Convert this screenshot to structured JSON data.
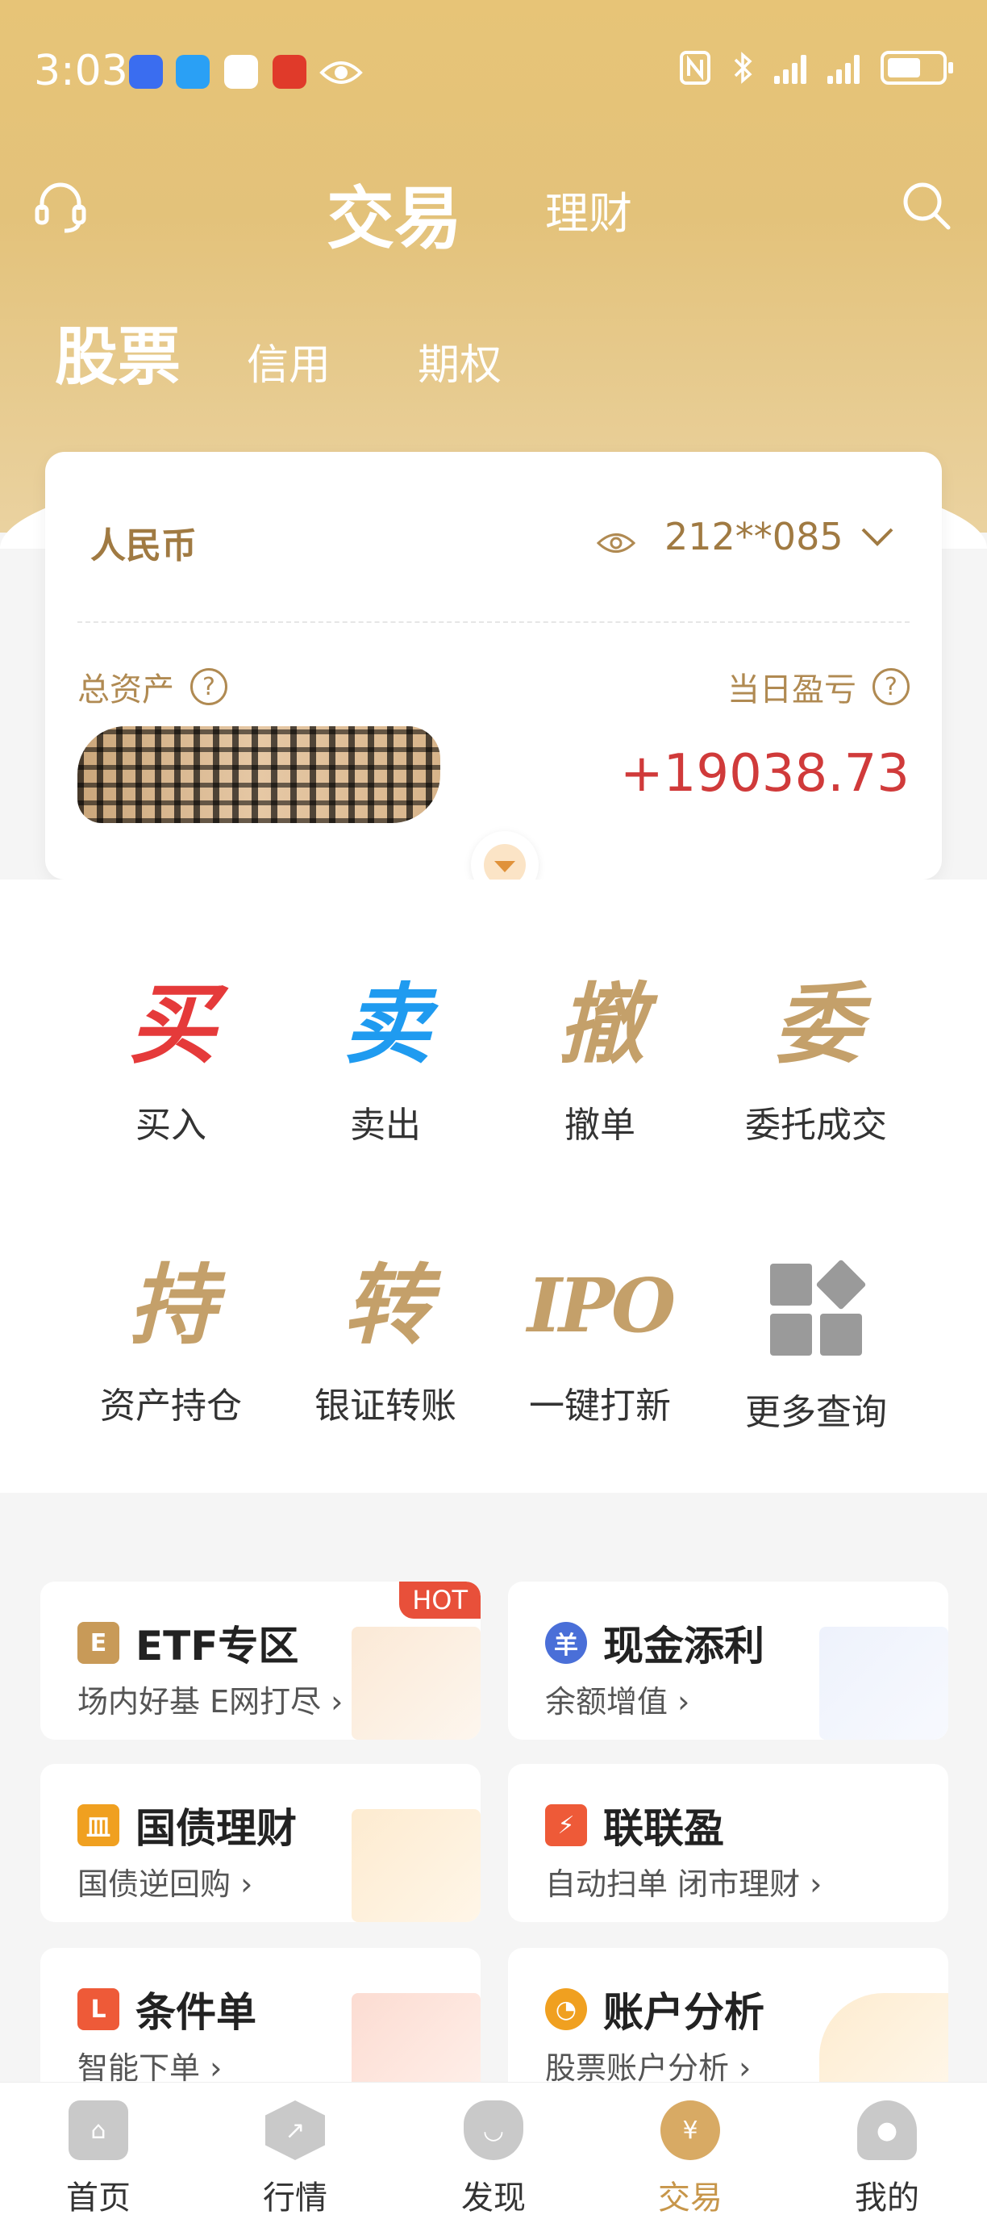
{
  "status_bar": {
    "time": "3:03"
  },
  "header": {
    "tab_main": "交易",
    "tab_sub": "理财"
  },
  "sub_tabs": [
    "股票",
    "信用",
    "期权"
  ],
  "account_card": {
    "currency": "人民币",
    "account": "212**085",
    "total_assets_label": "总资产",
    "total_assets_value": "",
    "daily_pnl_label": "当日盈亏",
    "daily_pnl_value": "+19038.73"
  },
  "quick_actions": [
    {
      "icon_char": "买",
      "label": "买入",
      "color": "#e53a3a"
    },
    {
      "icon_char": "卖",
      "label": "卖出",
      "color": "#1f9bf0"
    },
    {
      "icon_char": "撤",
      "label": "撤单",
      "color": "#c4a06a"
    },
    {
      "icon_char": "委",
      "label": "委托成交",
      "color": "#c4a06a"
    },
    {
      "icon_char": "持",
      "label": "资产持仓",
      "color": "#c4a06a"
    },
    {
      "icon_char": "转",
      "label": "银证转账",
      "color": "#c4a06a"
    },
    {
      "icon_char": "IPO",
      "label": "一键打新",
      "color": "#c4a06a"
    },
    {
      "icon_char": "",
      "label": "更多查询",
      "color": "#9a9a9a"
    }
  ],
  "features": [
    {
      "title": "ETF专区",
      "subtitle": "场内好基 E网打尽",
      "badge": "HOT",
      "icon": "E",
      "color": "#c89a58"
    },
    {
      "title": "现金添利",
      "subtitle": "余额增值",
      "badge": "",
      "icon": "羊",
      "color": "#4a6fd8"
    },
    {
      "title": "国债理财",
      "subtitle": "国债逆回购",
      "badge": "",
      "icon": "皿",
      "color": "#f0a020"
    },
    {
      "title": "联联盈",
      "subtitle": "自动扫单 闭市理财",
      "badge": "",
      "icon": "⚡",
      "color": "#ee5a38"
    },
    {
      "title": "条件单",
      "subtitle": "智能下单",
      "badge": "",
      "icon": "L",
      "color": "#ee5a38"
    },
    {
      "title": "账户分析",
      "subtitle": "股票账户分析",
      "badge": "",
      "icon": "◔",
      "color": "#f0a020"
    }
  ],
  "tab_bar": [
    {
      "label": "首页",
      "icon": "home-icon"
    },
    {
      "label": "行情",
      "icon": "market-icon"
    },
    {
      "label": "发现",
      "icon": "discover-icon"
    },
    {
      "label": "交易",
      "icon": "trade-icon",
      "active": true
    },
    {
      "label": "我的",
      "icon": "profile-icon"
    }
  ]
}
